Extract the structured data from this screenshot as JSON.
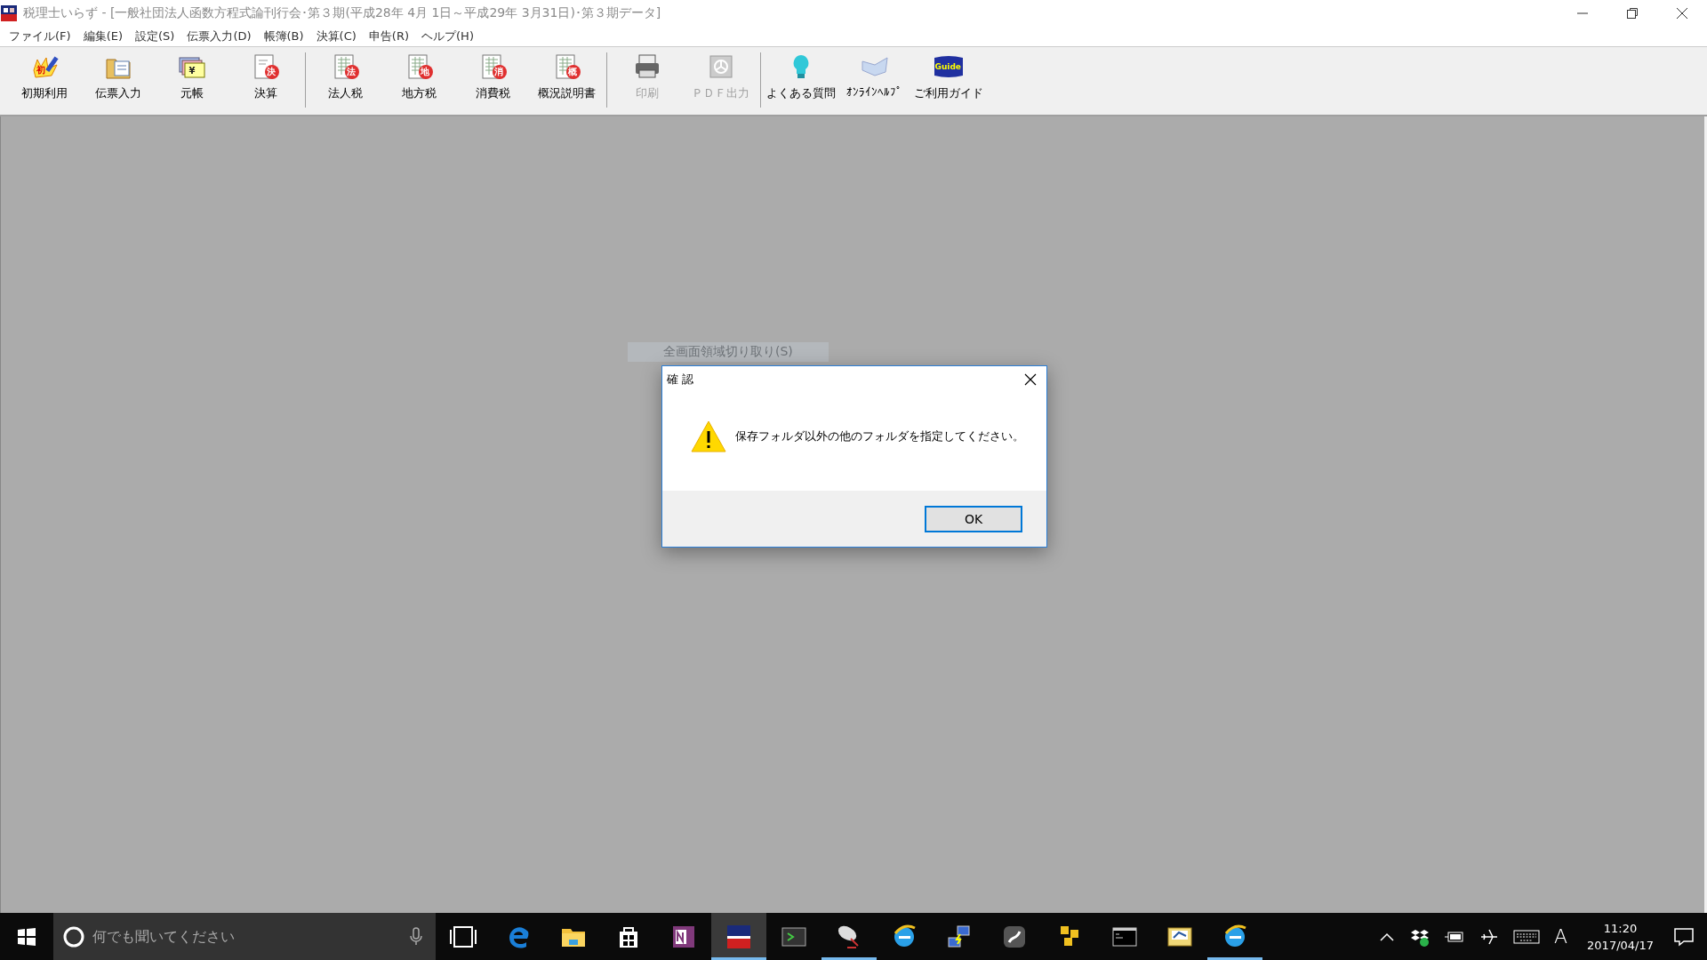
{
  "window": {
    "title": "税理士いらず - [一般社団法人函数方程式論刊行会･第３期(平成28年 4月 1日～平成29年 3月31日)･第３期データ]",
    "active": false
  },
  "menu": [
    "ファイル(F)",
    "編集(E)",
    "設定(S)",
    "伝票入力(D)",
    "帳簿(B)",
    "決算(C)",
    "申告(R)",
    "ヘルプ(H)"
  ],
  "toolbar": [
    [
      {
        "label": "初期利用",
        "badge": "初",
        "disabled": false
      },
      {
        "label": "伝票入力",
        "disabled": false
      },
      {
        "label": "元帳",
        "badge": "¥",
        "disabled": false
      },
      {
        "label": "決算",
        "badge": "決",
        "disabled": false
      }
    ],
    [
      {
        "label": "法人税",
        "badge": "法",
        "disabled": false
      },
      {
        "label": "地方税",
        "badge": "地",
        "disabled": false
      },
      {
        "label": "消費税",
        "badge": "消",
        "disabled": false
      },
      {
        "label": "概況説明書",
        "badge": "概",
        "disabled": false
      }
    ],
    [
      {
        "label": "印刷",
        "disabled": true
      },
      {
        "label": "ＰＤＦ出力",
        "disabled": true
      }
    ],
    [
      {
        "label": "よくある質問",
        "disabled": false
      },
      {
        "label": "ｵﾝﾗｲﾝﾍﾙﾌﾟ",
        "disabled": false
      },
      {
        "label": "ご利用ガイド",
        "badge": "Guide",
        "disabled": false
      }
    ]
  ],
  "overlay_hint": "全画面領域切り取り(S)",
  "dialog": {
    "title": "確 認",
    "message": "保存フォルダ以外の他のフォルダを指定してください。",
    "buttons": [
      {
        "label": "OK",
        "default": true
      }
    ]
  },
  "taskbar": {
    "search": {
      "placeholder": "何でも聞いてください"
    },
    "apps": [
      {
        "running": false,
        "selected": false
      },
      {
        "running": false,
        "selected": false
      },
      {
        "running": false,
        "selected": false
      },
      {
        "running": false,
        "selected": false
      },
      {
        "running": false,
        "selected": false
      },
      {
        "running": true,
        "selected": true
      },
      {
        "running": false,
        "selected": false
      },
      {
        "running": true,
        "selected": false
      },
      {
        "running": false,
        "selected": false
      },
      {
        "running": false,
        "selected": false
      },
      {
        "running": false,
        "selected": false
      },
      {
        "running": false,
        "selected": false
      },
      {
        "running": false,
        "selected": false
      },
      {
        "running": false,
        "selected": false
      },
      {
        "running": true,
        "selected": false
      }
    ],
    "ime": "A",
    "time": "11:20",
    "date": "2017/04/17"
  }
}
